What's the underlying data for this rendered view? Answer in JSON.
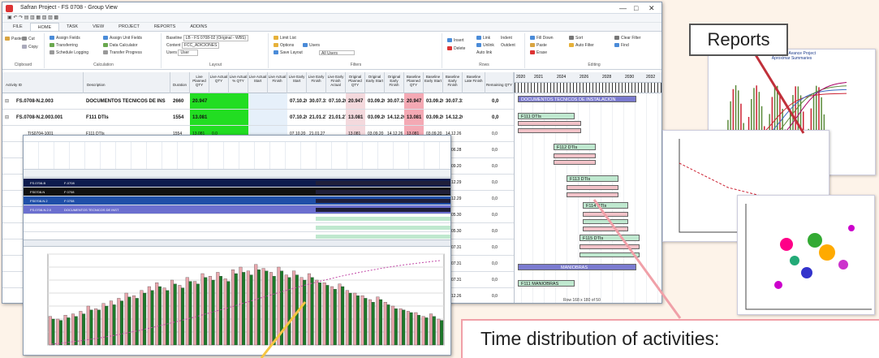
{
  "window": {
    "title": "Safran Project - FS 0708 - Group View",
    "controls": [
      "—",
      "□",
      "✕"
    ]
  },
  "ribbon": {
    "tabs": [
      "FILE",
      "HOME",
      "TASK",
      "VIEW",
      "PROJECT",
      "REPORTS",
      "ADDINS"
    ],
    "active_tab": "HOME",
    "clipboard": {
      "cut": "Cut",
      "copy": "Copy",
      "paste": "Paste",
      "label": "Clipboard"
    },
    "calculation": {
      "items": [
        "Assign Fields",
        "Assign Unit Fields",
        "Transferring",
        "Data Calculator",
        "Schedule Logging",
        "Transfer Progress"
      ],
      "label": "Calculation"
    },
    "layout": {
      "baseline_label": "Baseline",
      "baseline_value": "LB - FS 0708-02 (Original - WBS)",
      "content_label": "Content",
      "content_value": "FCC_ADICIONES",
      "user_label": "Users",
      "user_value": "User",
      "label": "Layout"
    },
    "filters": {
      "items": [
        "Limit List",
        "Options",
        "Users",
        "Save Layout",
        "All Users"
      ],
      "label": "Filters"
    },
    "rows": {
      "items": [
        "Insert",
        "Delete",
        "Link",
        "Unlink",
        "Indent",
        "Outdent",
        "Auto link"
      ],
      "label": "Rows"
    },
    "editing": {
      "items": [
        "Fill Down",
        "Paste",
        "Erase",
        "Sort",
        "Auto Filter",
        "Clear Filter",
        "Find"
      ],
      "label": "Editing"
    }
  },
  "grid": {
    "headers": [
      "Activity ID",
      "Description",
      "Duration",
      "Live Planned QTY",
      "Live Actual QTY",
      "Live Actual % QTY",
      "Live Actual Start",
      "Live Actual Finish",
      "Live Early Start",
      "Live Early Finish",
      "Live Early Finish Actual",
      "Original Planned QTY",
      "Original Early Start",
      "Original Early Finish",
      "Baseline Planned QTY",
      "Baseline Early Start",
      "Baseline Early Finish",
      "Baseline Late Finish",
      "Remaining QTY"
    ],
    "rows": [
      {
        "id": "FS.0708-N.2.003",
        "desc": "DOCUMENTOS TECNICOS DE INS",
        "dur": "2660",
        "pqty": "20.947",
        "a1": "",
        "a2": "",
        "d1": "07.10.20",
        "d2": "30.07.31",
        "d3": "07.10.20",
        "d4": "08.07.31",
        "o1": "20.947",
        "o2": "03.09.20",
        "o3": "30.07.31",
        "b1": "20.947",
        "b2": "03.09.20",
        "b3": "30.07.31",
        "rem": "0,0"
      },
      {
        "id": "FS.0708-N.2.003.001",
        "desc": "F111 DTIs",
        "dur": "1554",
        "pqty": "13.081",
        "a1": "",
        "a2": "",
        "d1": "07.10.20",
        "d2": "21.01.27",
        "d3": "07.10.20",
        "d4": "21.01.27",
        "o1": "13.081",
        "o2": "03.09.20",
        "o3": "14.12.26",
        "b1": "13.081",
        "b2": "03.09.20",
        "b3": "14.12.26",
        "rem": "0,0"
      },
      {
        "id": "TIS0704-1001",
        "desc": "F111 DTIs",
        "dur": "1554",
        "pqty": "13.081",
        "a1": "0,0",
        "a2": "",
        "d1": "07.10.20",
        "d2": "21.01.27",
        "d3": "",
        "d4": "",
        "o1": "13.081",
        "o2": "03.09.20",
        "o3": "14.12.26",
        "b1": "13.081",
        "b2": "03.09.20",
        "b3": "14.12.26",
        "rem": "0,0"
      }
    ],
    "right_rows": [
      {
        "b2": "02.06.23",
        "b3": "02.06.28",
        "rem": "0,0"
      },
      {
        "b2": "03.09.20",
        "b3": "03.09.20",
        "rem": "0,0"
      },
      {
        "b2": "02.10.23",
        "b3": "12.12.29",
        "rem": "0,0"
      },
      {
        "b2": "03.09.20",
        "b3": "12.12.29",
        "rem": "0,0"
      },
      {
        "b2": "02.10.25",
        "b3": "04.05.30",
        "rem": "0,0"
      },
      {
        "b2": "03.09.20",
        "b3": "04.05.30",
        "rem": "0,0"
      },
      {
        "b2": "01.10.26",
        "b3": "30.07.31",
        "rem": "0,0"
      },
      {
        "b2": "03.09.20",
        "b3": "30.07.31",
        "rem": "0,0"
      },
      {
        "b2": "03.09.20",
        "b3": "30.07.31",
        "rem": "0,0"
      },
      {
        "b2": "03.09.20",
        "b3": "14.12.26",
        "rem": "0,0"
      }
    ]
  },
  "gantt": {
    "years": [
      "2020",
      "2021",
      "2024",
      "2026",
      "2028",
      "2030",
      "2032"
    ],
    "bars": [
      "DOCUMENTOS TECNICOS DE INSTALACION",
      "F111 DTIs",
      "F112 DTIs",
      "F113 DTIs",
      "F114 DTIs",
      "F115 DTIs",
      "MANIOBRAS",
      "F111 MANIOBRAS"
    ],
    "status": "Row 168 x 180 of 50"
  },
  "inner_window": {
    "rows": [
      {
        "id": "FS.0708-B",
        "desc": "F-0708",
        "tone": "navy"
      },
      {
        "id": "FS0708-N",
        "desc": "F 0708",
        "tone": "black"
      },
      {
        "id": "FS0708-N.2",
        "desc": "F 0708",
        "tone": "blue"
      },
      {
        "id": "FS.0708-N.2.0",
        "desc": "DOCUMENTOS TECNICOS DE INST",
        "tone": "purple"
      },
      {
        "id": "",
        "desc": "",
        "tone": "white"
      },
      {
        "id": "",
        "desc": "",
        "tone": "white"
      },
      {
        "id": "",
        "desc": "",
        "tone": "white"
      }
    ],
    "chart_data": {
      "type": "bar",
      "series": [
        {
          "values": [
            22,
            20,
            23,
            24,
            26,
            30,
            28,
            32,
            34,
            36,
            40,
            38,
            42,
            45,
            48,
            44,
            50,
            46,
            52,
            49,
            55,
            53,
            56,
            51,
            58,
            60,
            57,
            62,
            59,
            56,
            60,
            54,
            57,
            52,
            55,
            50,
            48,
            45,
            47,
            42,
            40,
            38,
            35,
            37,
            33,
            30,
            28,
            26,
            25,
            22,
            24,
            20
          ]
        },
        {
          "values": [
            20,
            19,
            21,
            22,
            24,
            27,
            27,
            30,
            31,
            34,
            37,
            36,
            40,
            42,
            45,
            42,
            47,
            44,
            49,
            47,
            52,
            50,
            53,
            49,
            55,
            56,
            54,
            58,
            57,
            53,
            57,
            52,
            54,
            50,
            52,
            48,
            46,
            43,
            45,
            40,
            38,
            36,
            33,
            35,
            31,
            28,
            27,
            25,
            23,
            21,
            22,
            19
          ]
        }
      ],
      "ylim": [
        0,
        70
      ]
    }
  },
  "reports": {
    "label": "Reports",
    "report1": {
      "title": "Estimacion Avance Project",
      "subtitle": "Aproximar Summaries"
    }
  },
  "annotation": {
    "label": "Time distribution of activities:"
  },
  "colors": {
    "callout_border": "#555555",
    "pointer_red": "#c0303a",
    "pointer_pink": "#f0a0a8",
    "pointer_yellow": "#f5c542",
    "grid_green": "#22dd22",
    "gantt_purple": "#7b7bd0",
    "gantt_green": "#bfe8cf",
    "gantt_pink": "#f2c2c8"
  }
}
